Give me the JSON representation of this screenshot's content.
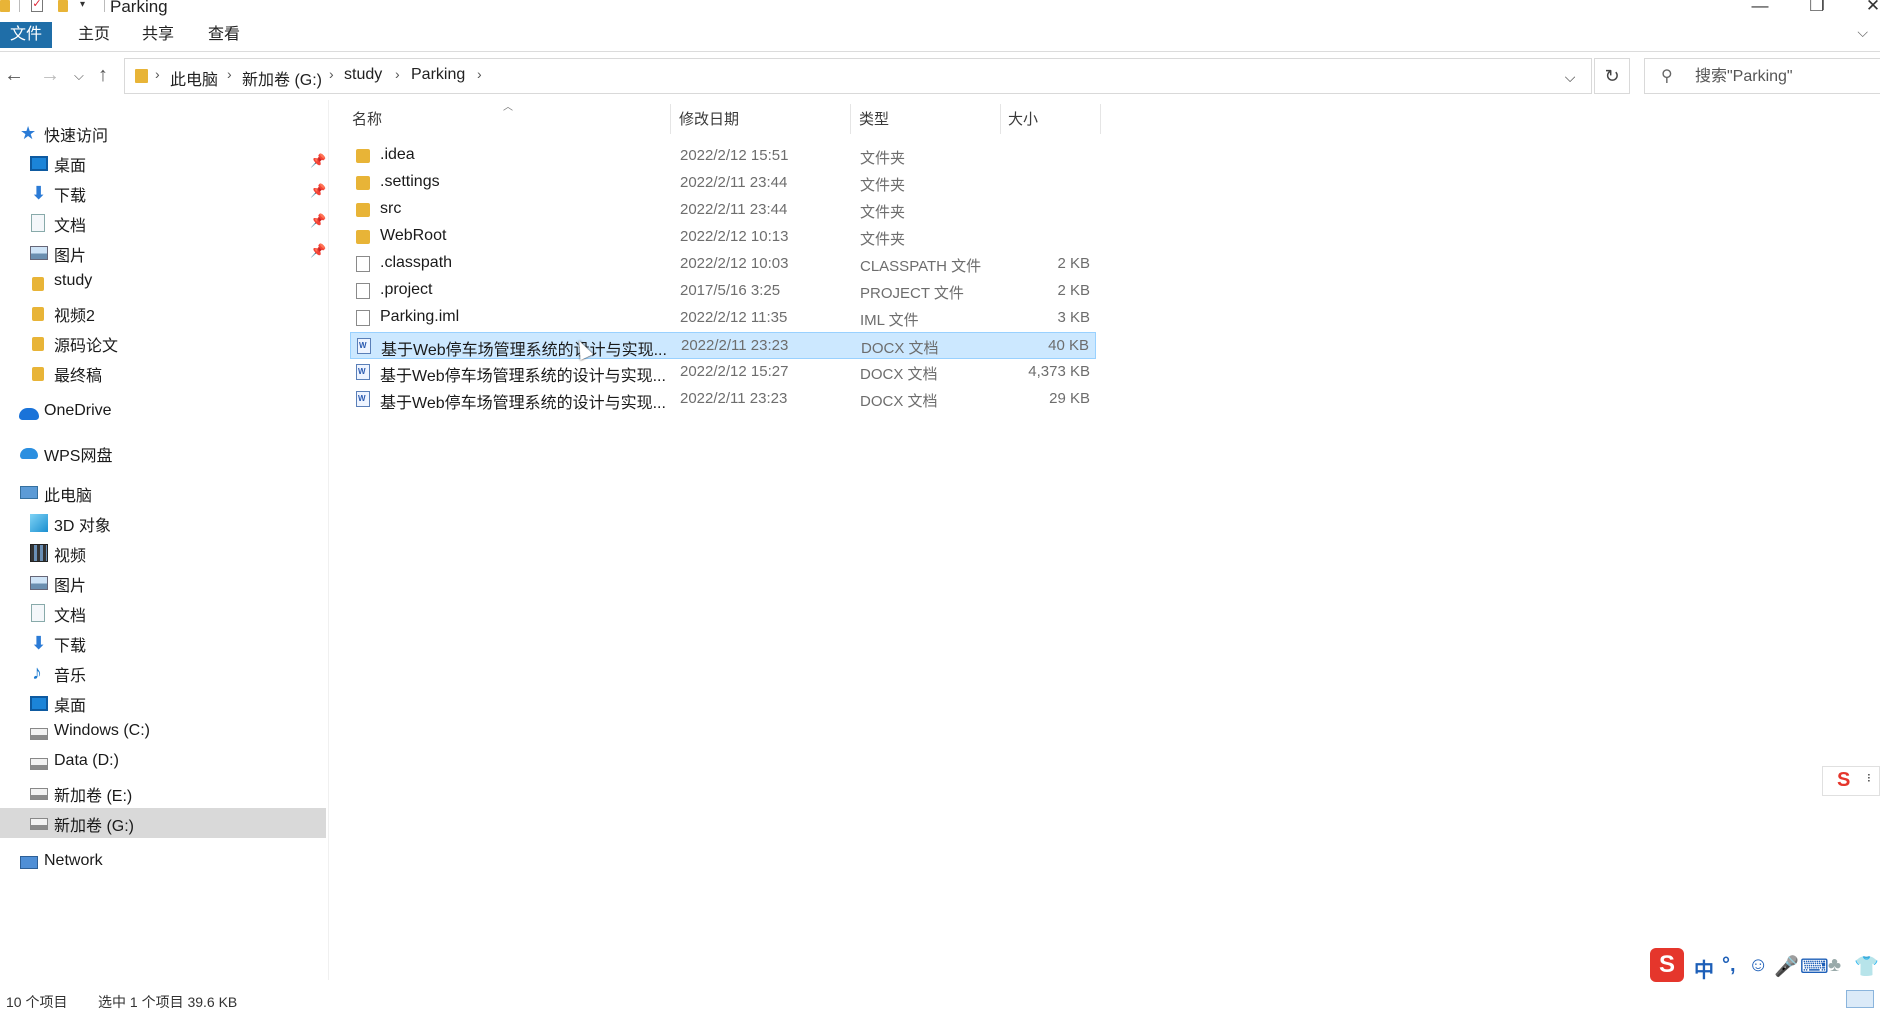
{
  "window": {
    "title": "Parking",
    "minimize": "—",
    "restore": "❐",
    "close": "✕"
  },
  "ribbon": {
    "tabs": [
      {
        "label": "文件"
      },
      {
        "label": "主页"
      },
      {
        "label": "共享"
      },
      {
        "label": "查看"
      }
    ]
  },
  "address": {
    "crumbs": [
      "此电脑",
      "新加卷 (G:)",
      "study",
      "Parking"
    ]
  },
  "search": {
    "placeholder": "搜索\"Parking\""
  },
  "sidebar": {
    "items": [
      {
        "label": "快速访问"
      },
      {
        "label": "桌面"
      },
      {
        "label": "下载"
      },
      {
        "label": "文档"
      },
      {
        "label": "图片"
      },
      {
        "label": "study"
      },
      {
        "label": "视频2"
      },
      {
        "label": "源码论文"
      },
      {
        "label": "最终稿"
      },
      {
        "label": "OneDrive"
      },
      {
        "label": "WPS网盘"
      },
      {
        "label": "此电脑"
      },
      {
        "label": "3D 对象"
      },
      {
        "label": "视频"
      },
      {
        "label": "图片"
      },
      {
        "label": "文档"
      },
      {
        "label": "下载"
      },
      {
        "label": "音乐"
      },
      {
        "label": "桌面"
      },
      {
        "label": "Windows (C:)"
      },
      {
        "label": "Data (D:)"
      },
      {
        "label": "新加卷 (E:)"
      },
      {
        "label": "新加卷 (G:)"
      },
      {
        "label": "Network"
      }
    ]
  },
  "columns": {
    "name": "名称",
    "date": "修改日期",
    "type": "类型",
    "size": "大小"
  },
  "files": [
    {
      "name": ".idea",
      "date": "2022/2/12 15:51",
      "type": "文件夹",
      "size": ""
    },
    {
      "name": ".settings",
      "date": "2022/2/11 23:44",
      "type": "文件夹",
      "size": ""
    },
    {
      "name": "src",
      "date": "2022/2/11 23:44",
      "type": "文件夹",
      "size": ""
    },
    {
      "name": "WebRoot",
      "date": "2022/2/12 10:13",
      "type": "文件夹",
      "size": ""
    },
    {
      "name": ".classpath",
      "date": "2022/2/12 10:03",
      "type": "CLASSPATH 文件",
      "size": "2 KB"
    },
    {
      "name": ".project",
      "date": "2017/5/16 3:25",
      "type": "PROJECT 文件",
      "size": "2 KB"
    },
    {
      "name": "Parking.iml",
      "date": "2022/2/12 11:35",
      "type": "IML 文件",
      "size": "3 KB"
    },
    {
      "name": "基于Web停车场管理系统的设计与实现...",
      "date": "2022/2/11 23:23",
      "type": "DOCX 文档",
      "size": "40 KB"
    },
    {
      "name": "基于Web停车场管理系统的设计与实现...",
      "date": "2022/2/12 15:27",
      "type": "DOCX 文档",
      "size": "4,373 KB"
    },
    {
      "name": "基于Web停车场管理系统的设计与实现...",
      "date": "2022/2/11 23:23",
      "type": "DOCX 文档",
      "size": "29 KB"
    }
  ],
  "status": {
    "count": "10 个项目",
    "selection": "选中 1 个项目  39.6 KB"
  },
  "ime": {
    "float_logo": "S",
    "float_more": "⁝",
    "logo": "S",
    "glyphs": [
      "中",
      "°,",
      "☺",
      "🎤",
      "⌨",
      "♣",
      "👕"
    ]
  }
}
